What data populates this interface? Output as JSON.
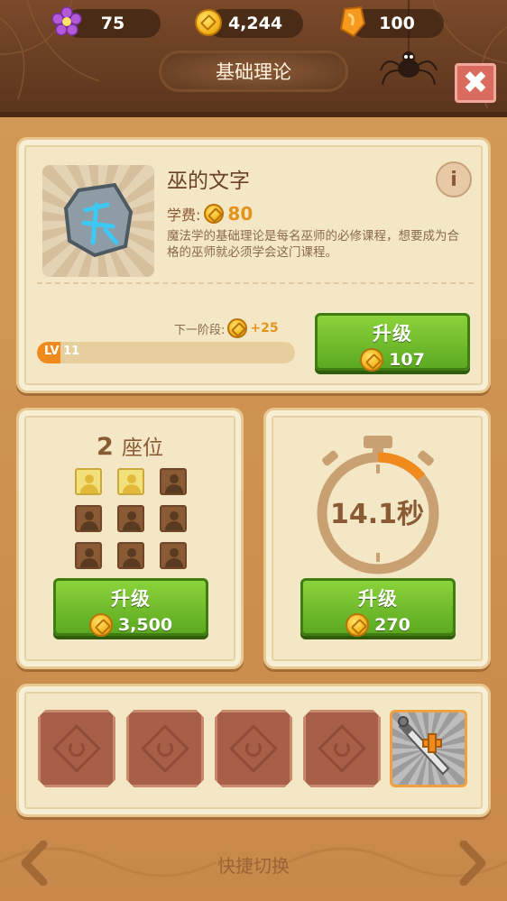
{
  "resources": {
    "gems": "75",
    "gold": "4,244",
    "crystals": "100"
  },
  "header": {
    "title": "基础理论",
    "close_label": "✖"
  },
  "course": {
    "name": "巫的文字",
    "fee_label": "学费:",
    "fee_value": "80",
    "description": "魔法学的基础理论是每名巫师的必修课程，想要成为合格的巫师就必须学会这门课程。",
    "info_label": "i",
    "next_stage_label": "下一阶段:",
    "next_stage_bonus": "+25",
    "level_label": "LV 11",
    "level_progress": 0.09,
    "upgrade": {
      "label": "升级",
      "cost": "107"
    }
  },
  "seats": {
    "count": "2",
    "label": "座位",
    "grid": [
      true,
      true,
      false,
      false,
      false,
      false,
      false,
      false,
      false
    ],
    "upgrade": {
      "label": "升级",
      "cost": "3,500"
    }
  },
  "timer": {
    "value": "14.1秒",
    "upgrade": {
      "label": "升级",
      "cost": "270"
    }
  },
  "slots": {
    "items": [
      "empty",
      "empty",
      "empty",
      "empty",
      "sword-add"
    ]
  },
  "footer": {
    "label": "快捷切换"
  },
  "colors": {
    "accent_green": "#6bb82a",
    "gold": "#f6b51d",
    "brown": "#6b4226"
  }
}
